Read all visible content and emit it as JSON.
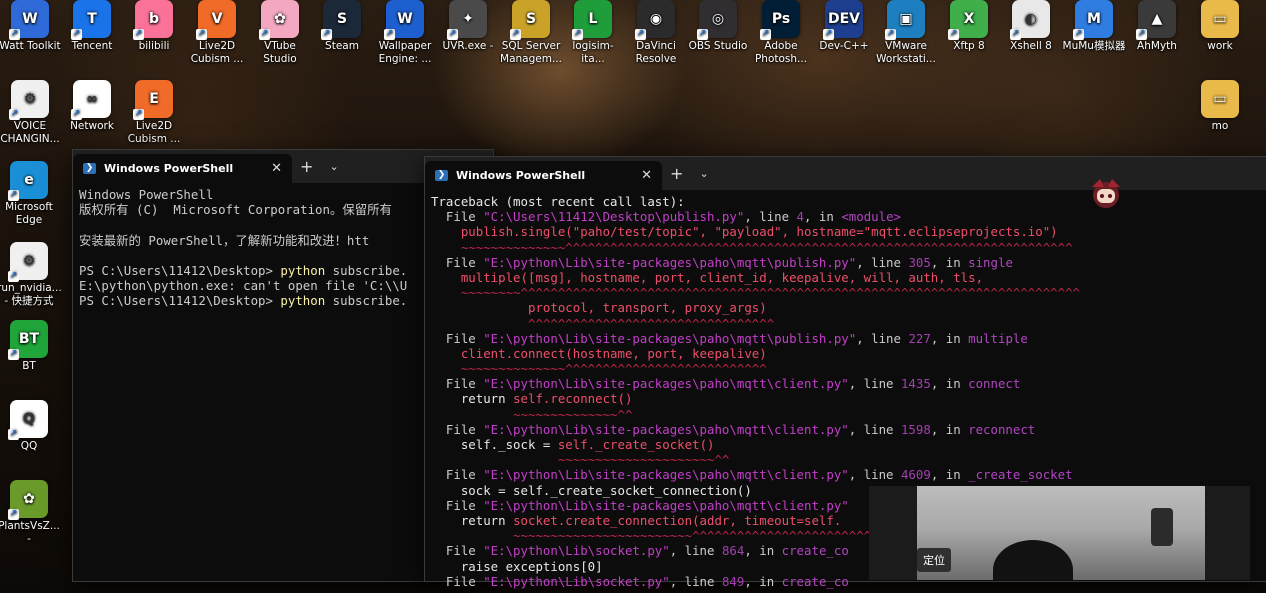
{
  "desktop_icons": [
    {
      "label": "Watt Toolkit",
      "icon": "watt-toolkit-icon",
      "color": "#2e6bd8",
      "glyph": "W"
    },
    {
      "label": "Tencent",
      "icon": "tencent-meeting-icon",
      "color": "#1a73e8",
      "glyph": "T"
    },
    {
      "label": "bilibili",
      "icon": "bilibili-icon",
      "color": "#fb7299",
      "glyph": "b"
    },
    {
      "label": "Live2D Cubism ...",
      "icon": "live2d-viewer-icon",
      "color": "#f06a28",
      "glyph": "V"
    },
    {
      "label": "VTube Studio",
      "icon": "vtube-studio-icon",
      "color": "#f4a7c1",
      "glyph": "✿"
    },
    {
      "label": "Steam",
      "icon": "steam-icon",
      "color": "#1b2838",
      "glyph": "S"
    },
    {
      "label": "Wallpaper Engine: ...",
      "icon": "wallpaper-engine-icon",
      "color": "#1d5fcf",
      "glyph": "W"
    },
    {
      "label": "UVR.exe -",
      "icon": "uvr-icon",
      "color": "#4a4a4a",
      "glyph": "✦"
    },
    {
      "label": "SQL Server Managem...",
      "icon": "sql-server-icon",
      "color": "#c9a227",
      "glyph": "S"
    },
    {
      "label": "logisim-ita...",
      "icon": "logisim-icon",
      "color": "#1f9d3a",
      "glyph": "L"
    },
    {
      "label": "DaVinci Resolve",
      "icon": "davinci-resolve-icon",
      "color": "#2b2b2b",
      "glyph": "◉"
    },
    {
      "label": "OBS Studio",
      "icon": "obs-studio-icon",
      "color": "#302e31",
      "glyph": "◎"
    },
    {
      "label": "Adobe Photosh...",
      "icon": "photoshop-icon",
      "color": "#001e36",
      "glyph": "Ps"
    },
    {
      "label": "Dev-C++",
      "icon": "dev-cpp-icon",
      "color": "#1e3f8f",
      "glyph": "DEV"
    },
    {
      "label": "VMware Workstati...",
      "icon": "vmware-icon",
      "color": "#1d7fc0",
      "glyph": "▣"
    },
    {
      "label": "Xftp 8",
      "icon": "xftp-icon",
      "color": "#3fae4b",
      "glyph": "X"
    },
    {
      "label": "Xshell 8",
      "icon": "xshell-icon",
      "color": "#e8e8e8",
      "glyph": "◐"
    },
    {
      "label": "MuMu模拟器",
      "icon": "mumu-emulator-icon",
      "color": "#2f7de1",
      "glyph": "M"
    },
    {
      "label": "AhMyth",
      "icon": "ahmyth-icon",
      "color": "#3a3a3a",
      "glyph": "▲"
    },
    {
      "label": "work",
      "icon": "folder-icon",
      "color": "#e9b949",
      "glyph": "▭"
    }
  ],
  "desktop_icons_row2": [
    {
      "label": "VOICE CHANGIN...",
      "icon": "voice-changer-icon",
      "color": "#f0f0f0",
      "glyph": "⚙"
    },
    {
      "label": "Network",
      "icon": "network-icon",
      "color": "#ffffff",
      "glyph": "∞"
    },
    {
      "label": "Live2D Cubism ...",
      "icon": "live2d-editor-icon",
      "color": "#f06a28",
      "glyph": "E"
    },
    {
      "label": "mo",
      "icon": "folder-icon",
      "color": "#e9b949",
      "glyph": "▭"
    }
  ],
  "desktop_icons_left": [
    {
      "label": "Microsoft Edge",
      "icon": "edge-icon",
      "color": "#1a8fd6",
      "glyph": "e"
    },
    {
      "label": "run_nvidia... - 快捷方式",
      "icon": "batch-file-icon",
      "color": "#f0f0f0",
      "glyph": "⚙"
    },
    {
      "label": "BT",
      "icon": "bt-panel-icon",
      "color": "#20a53a",
      "glyph": "BT"
    },
    {
      "label": "QQ",
      "icon": "qq-icon",
      "color": "#ffffff",
      "glyph": "Q"
    },
    {
      "label": "PlantsVsZ... -",
      "icon": "plants-vs-zombies-icon",
      "color": "#6a9a2a",
      "glyph": "✿"
    }
  ],
  "window_back": {
    "tab_title": "Windows PowerShell",
    "lines": [
      "Windows PowerShell",
      "版权所有 (C)  Microsoft Corporation。保留所有",
      "",
      "安装最新的 PowerShell，了解新功能和改进！htt",
      "",
      "PS C:\\Users\\11412\\Desktop> |python| subscribe.",
      "E:\\python\\python.exe: can't open file 'C:\\\\U",
      "PS C:\\Users\\11412\\Desktop> |python| subscribe."
    ]
  },
  "window_front": {
    "tab_title": "Windows PowerShell",
    "traceback_header": "Traceback (most recent call last):",
    "frames": [
      {
        "file": "C:\\Users\\11412\\Desktop\\publish.py",
        "line": "4",
        "func": "<module>",
        "code": [
          "publish.single(\"paho/test/topic\", \"payload\", hostname=\"mqtt.eclipseprojects.io\")"
        ],
        "squig": "~~~~~~~~~~~~~~^^^^^^^^^^^^^^^^^^^^^^^^^^^^^^^^^^^^^^^^^^^^^^^^^^^^^^^^^^^^^^^^^^^^"
      },
      {
        "file": "E:\\python\\Lib\\site-packages\\paho\\mqtt\\publish.py",
        "line": "305",
        "func": "single",
        "code": [
          "multiple([msg], hostname, port, client_id, keepalive, will, auth, tls,",
          "         protocol, transport, proxy_args)"
        ],
        "squig": "~~~~~~~~^^^^^^^^^^^^^^^^^^^^^^^^^^^^^^^^^^^^^^^^^^^^^^^^^^^^^^^^^^^^^^^^^^^^^^^^^^^",
        "squig2": "         ^^^^^^^^^^^^^^^^^^^^^^^^^^^^^^^^^"
      },
      {
        "file": "E:\\python\\Lib\\site-packages\\paho\\mqtt\\publish.py",
        "line": "227",
        "func": "multiple",
        "code": [
          "client.connect(hostname, port, keepalive)"
        ],
        "squig": "~~~~~~~~~~~~~~^^^^^^^^^^^^^^^^^^^^^^^^^^^"
      },
      {
        "file": "E:\\python\\Lib\\site-packages\\paho\\mqtt\\client.py",
        "line": "1435",
        "func": "connect",
        "code_plain": "return ",
        "code": [
          "self.reconnect()"
        ],
        "squig": "       ~~~~~~~~~~~~~~^^"
      },
      {
        "file": "E:\\python\\Lib\\site-packages\\paho\\mqtt\\client.py",
        "line": "1598",
        "func": "reconnect",
        "code_plain": "self._sock = ",
        "code": [
          "self._create_socket()"
        ],
        "squig": "             ~~~~~~~~~~~~~~~~~~~~~^^"
      },
      {
        "file": "E:\\python\\Lib\\site-packages\\paho\\mqtt\\client.py",
        "line": "4609",
        "func": "_create_socket",
        "code_plain": "sock = self._create_socket_connection()",
        "code": []
      },
      {
        "file": "E:\\python\\Lib\\site-packages\\paho\\mqtt\\client.py",
        "line": "",
        "func": "",
        "code_plain": "return ",
        "code": [
          "socket.create_connection(addr, timeout=self."
        ],
        "squig": "       ~~~~~~~~~~~~~~~~~~~~~~~~^^^^^^^^^^^^^^^^^^^^^^^^^^^^^^^^^^^"
      },
      {
        "file": "E:\\python\\Lib\\socket.py",
        "line": "864",
        "func": "create_co",
        "code_plain": "raise exceptions[0]",
        "code": []
      },
      {
        "file": "E:\\python\\Lib\\socket.py",
        "line": "849",
        "func": "create_co",
        "code": []
      }
    ]
  },
  "webcam": {
    "locate_label": "定位"
  }
}
